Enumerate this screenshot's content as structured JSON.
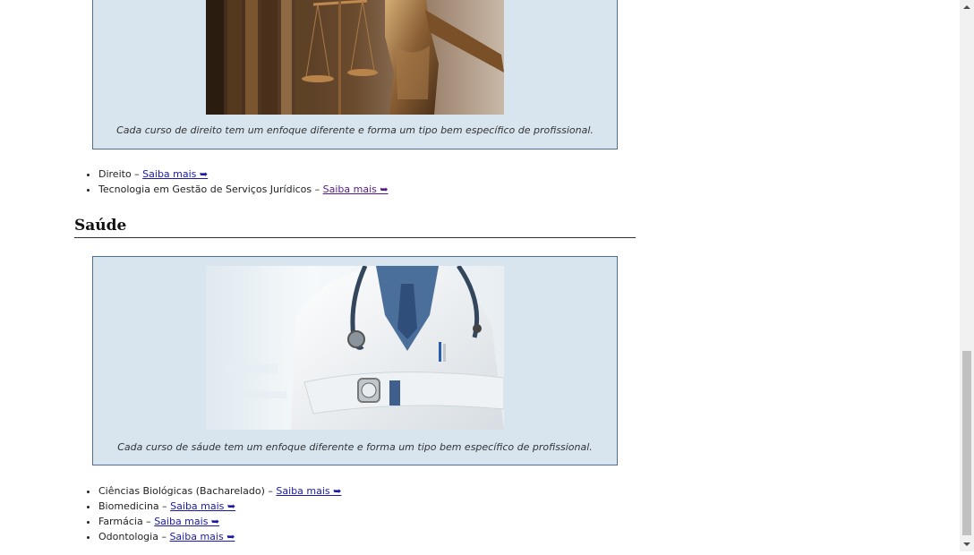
{
  "law_section": {
    "figure_caption": "Cada curso de direito tem um enfoque diferente e forma um tipo bem específico de profissional.",
    "courses": [
      {
        "name": "Direito – ",
        "link": " Saiba mais ➥"
      },
      {
        "name": "Tecnologia em Gestão de Serviços Jurídicos – ",
        "link": " Saiba mais ➥"
      }
    ]
  },
  "health_section": {
    "title": "Saúde",
    "figure_caption": "Cada curso de sáude tem um enfoque diferente e forma um tipo bem específico de profissional.",
    "courses": [
      {
        "name": "Ciências Biológicas (Bacharelado) – ",
        "link": " Saiba mais ➥"
      },
      {
        "name": "Biomedicina – ",
        "link": " Saiba mais ➥"
      },
      {
        "name": "Farmácia – ",
        "link": " Saiba mais ➥"
      },
      {
        "name": "Odontologia – ",
        "link": " Saiba mais ➥"
      }
    ]
  },
  "colors": {
    "figure_background": "#d8e5ef",
    "figure_border": "#4d6f94",
    "link": "#1a1aa6",
    "visited_link": "#551a8b"
  }
}
